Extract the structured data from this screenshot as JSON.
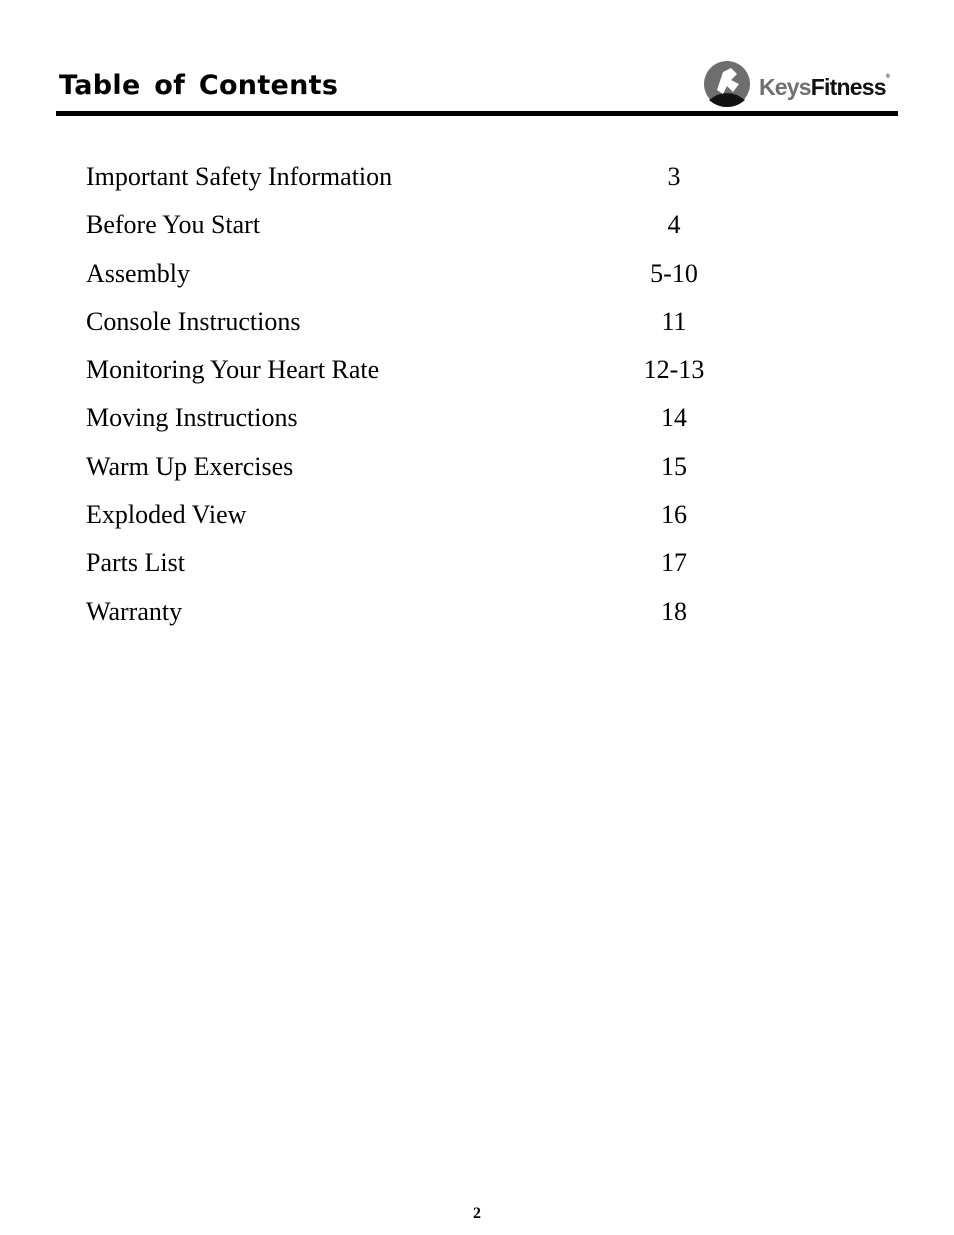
{
  "header": {
    "title": "Table of Contents",
    "logo": {
      "icon": "keys-fitness-runner-logo-icon",
      "text_part1": "Keys",
      "text_part2": "Fitness",
      "trademark": "®"
    }
  },
  "toc": {
    "entries": [
      {
        "label": "Important Safety Information",
        "page": "3"
      },
      {
        "label": "Before You Start",
        "page": "4"
      },
      {
        "label": "Assembly",
        "page": "5-10"
      },
      {
        "label": "Console Instructions",
        "page": "11"
      },
      {
        "label": "Monitoring Your Heart Rate",
        "page": "12-13"
      },
      {
        "label": "Moving Instructions",
        "page": "14"
      },
      {
        "label": "Warm Up Exercises",
        "page": "15"
      },
      {
        "label": "Exploded View",
        "page": "16"
      },
      {
        "label": "Parts List",
        "page": "17"
      },
      {
        "label": "Warranty",
        "page": "18"
      }
    ]
  },
  "footer": {
    "page_number": "2"
  }
}
